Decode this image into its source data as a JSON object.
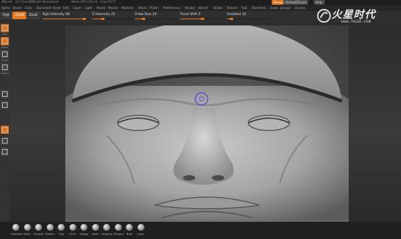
{
  "app": {
    "title_items": [
      "ZBrush",
      "3.5 [Core]",
      "ZBrush Document",
      "Mem:187+52+8",
      "Free:1177"
    ],
    "top_buttons": [
      {
        "label": "Menus",
        "style": "orange"
      },
      {
        "label": "DefaultZScript",
        "style": "gray"
      },
      {
        "label": "Help",
        "style": "gray"
      }
    ]
  },
  "menu": [
    "Alpha",
    "Brush",
    "Color",
    "Document",
    "Draw",
    "Edit",
    "Layer",
    "Light",
    "Macro",
    "Marker",
    "Material",
    "Movie",
    "Picker",
    "Preferences",
    "Render",
    "Stencil",
    "Stroke",
    "Texture",
    "Tool",
    "Transform",
    "Zoom",
    "Zplugin",
    "Zscript"
  ],
  "toolbar": {
    "segments": [
      {
        "label": "Rgb",
        "active": false
      },
      {
        "label": "Zadd",
        "active": true
      },
      {
        "label": "Zsub",
        "active": false
      }
    ],
    "sliders": [
      {
        "label": "Rgb Intensity 98",
        "value": 0.98
      },
      {
        "label": "Z Intensity 25",
        "value": 0.25
      },
      {
        "label": "Draw Size 24",
        "value": 0.19
      },
      {
        "label": "Focal Shift 0",
        "value": 0.5
      },
      {
        "label": "Doubled 10",
        "value": 0.1
      }
    ]
  },
  "left_shelf": {
    "items": [
      {
        "icon": "edit-icon",
        "label": "Edit",
        "style": "orange"
      },
      {
        "icon": "move-icon",
        "label": "Move",
        "style": "orange"
      },
      {
        "icon": "scale-icon",
        "label": "Scale",
        "style": "dark"
      },
      {
        "icon": "rotate-icon",
        "label": "Rotate",
        "style": "dark"
      },
      {
        "icon": "stroke-icon",
        "label": "",
        "style": "dark"
      },
      {
        "icon": "material-icon",
        "label": "",
        "style": "dark"
      },
      {
        "icon": "color-icon",
        "label": "",
        "style": "orange"
      },
      {
        "icon": "perspective-icon",
        "label": "",
        "style": "dark"
      },
      {
        "icon": "xyz-icon",
        "label": "",
        "style": "dark"
      }
    ]
  },
  "brushes": [
    "Standard",
    "Move",
    "Smooth",
    "Flatten",
    "Clay",
    "Pinch",
    "Nudge",
    "Slash",
    "Magnify",
    "ZProject",
    "Blob",
    "Layer"
  ],
  "watermark": {
    "title": "火星时代",
    "url": "www.hxsd.com"
  }
}
